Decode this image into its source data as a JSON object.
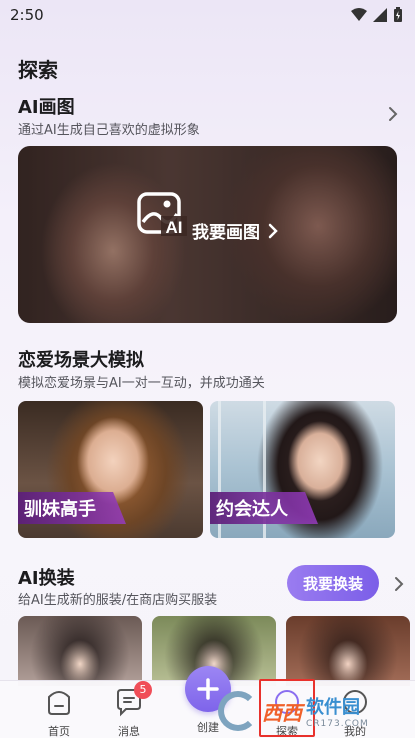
{
  "status_bar": {
    "time": "2:50"
  },
  "page": {
    "title": "探索"
  },
  "ai_draw": {
    "title": "AI画图",
    "subtitle": "通过AI生成自己喜欢的虚拟形象",
    "logo_text": "AI",
    "cta": "我要画图"
  },
  "love_sim": {
    "title": "恋爱场景大模拟",
    "subtitle": "模拟恋爱场景与AI一对一互动，并成功通关",
    "cards": [
      {
        "label": "驯妹高手"
      },
      {
        "label": "约会达人"
      }
    ]
  },
  "ai_outfit": {
    "title": "AI换装",
    "subtitle": "给AI生成新的服装/在商店购买服装",
    "button": "我要换装"
  },
  "tabbar": {
    "items": [
      {
        "label": "首页"
      },
      {
        "label": "消息",
        "badge": "5"
      },
      {
        "label": "创建"
      },
      {
        "label": "探索"
      },
      {
        "label": "我的"
      }
    ]
  },
  "watermark": {
    "brand": "西西",
    "cn": "软件园",
    "url": "CR173.COM"
  },
  "colors": {
    "accent": "#8a6ef0",
    "badge": "#f04e58",
    "highlight": "#e8312c"
  }
}
